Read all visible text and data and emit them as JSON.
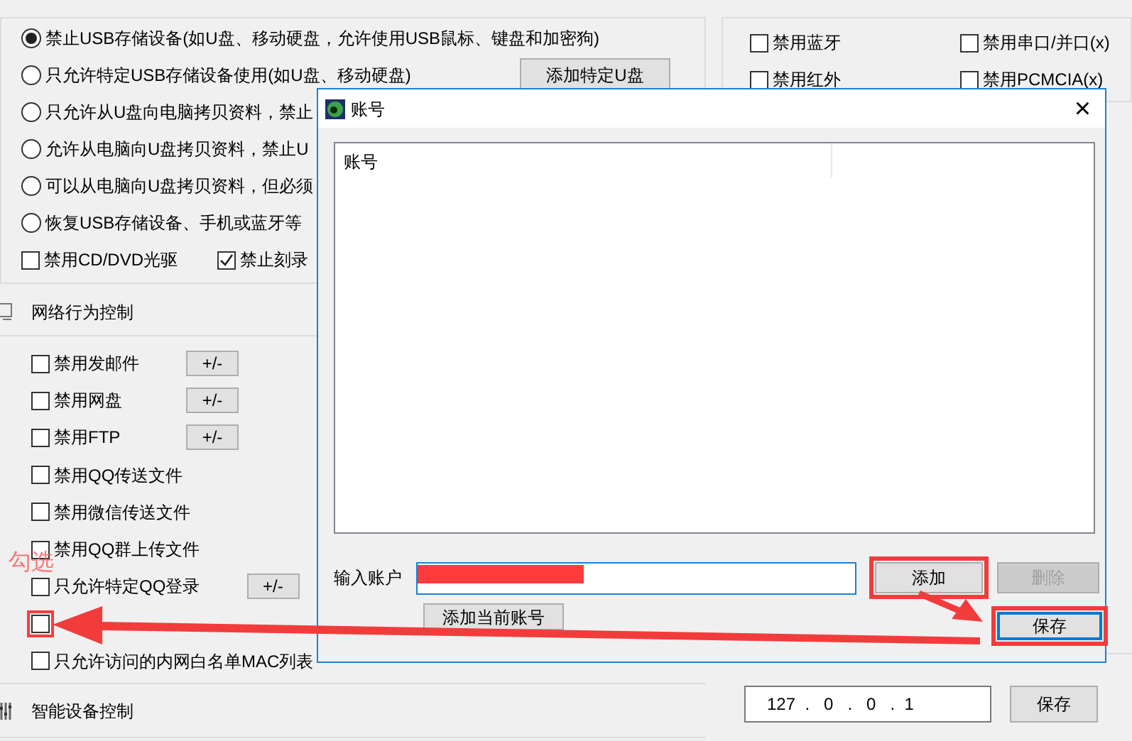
{
  "storage": {
    "options": [
      {
        "label": "禁止USB存储设备(如U盘、移动硬盘，允许使用USB鼠标、键盘和加密狗)",
        "selected": true
      },
      {
        "label": "只允许特定USB存储设备使用(如U盘、移动硬盘)",
        "selected": false
      },
      {
        "label": "只允许从U盘向电脑拷贝资料，禁止",
        "selected": false
      },
      {
        "label": "允许从电脑向U盘拷贝资料，禁止U",
        "selected": false
      },
      {
        "label": "可以从电脑向U盘拷贝资料，但必须",
        "selected": false
      },
      {
        "label": "恢复USB存储设备、手机或蓝牙等",
        "selected": false
      }
    ],
    "add_button": "添加特定U盘",
    "checks": [
      {
        "label": "禁用CD/DVD光驱",
        "checked": false
      },
      {
        "label": "禁止刻录",
        "checked": true
      }
    ]
  },
  "network": {
    "title": "网络行为控制",
    "items": [
      {
        "label": "禁用发邮件",
        "checked": false,
        "highlighted": false,
        "button": "+/-"
      },
      {
        "label": "禁用网盘",
        "checked": false,
        "highlighted": false,
        "button": "+/-"
      },
      {
        "label": "禁用FTP",
        "checked": false,
        "highlighted": false,
        "button": "+/-"
      },
      {
        "label": "禁用QQ传送文件",
        "checked": false,
        "highlighted": false
      },
      {
        "label": "禁用微信传送文件",
        "checked": false,
        "highlighted": false
      },
      {
        "label": "禁用QQ群上传文件",
        "checked": false,
        "highlighted": false
      },
      {
        "label": "只允许特定QQ登录",
        "checked": false,
        "highlighted": false,
        "button": "+/-"
      },
      {
        "checked": false,
        "highlighted": true
      },
      {
        "label": "只允许访问的内网白名单MAC列表",
        "checked": false,
        "highlighted": false
      }
    ]
  },
  "smart_devices": {
    "title": "智能设备控制"
  },
  "ports": {
    "items": [
      {
        "label": "禁用蓝牙",
        "checked": false
      },
      {
        "label": "禁用串口/并口(x)",
        "checked": false
      },
      {
        "label": "禁用红外",
        "checked": false
      },
      {
        "label": "禁用PCMCIA(x)",
        "checked": false
      }
    ]
  },
  "ip_field": {
    "value": "127  .   0   .   0   .  1"
  },
  "ip_save_button": "保存",
  "dialog": {
    "title": "账号",
    "close": "×",
    "columns": [
      "账号"
    ],
    "input_label": "输入账户",
    "buttons": [
      {
        "label": "添加",
        "kind": "add",
        "highlighted": true,
        "disabled": false,
        "focused": false
      },
      {
        "label": "删除",
        "kind": "delete",
        "highlighted": false,
        "disabled": true,
        "focused": false
      },
      {
        "label": "添加当前账号",
        "kind": "add_current",
        "highlighted": false,
        "disabled": false,
        "focused": false
      },
      {
        "label": "保存",
        "kind": "save",
        "highlighted": true,
        "disabled": false,
        "focused": true
      }
    ]
  },
  "annotation": {
    "text": "勾选"
  }
}
